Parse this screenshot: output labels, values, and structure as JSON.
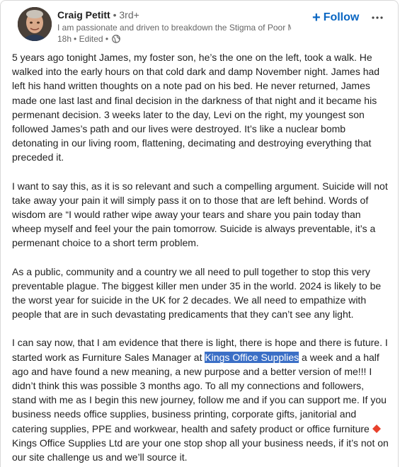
{
  "author": {
    "name": "Craig Petitt",
    "degree": "• 3rd+",
    "headline": "I am passionate and driven to breakdown the Stigma of Poor M...",
    "time": "18h",
    "edited": "• Edited •",
    "visibility_icon": "globe-icon"
  },
  "actions": {
    "follow_plus": "+",
    "follow_label": "Follow",
    "more_label": "•••"
  },
  "post": {
    "p1": "5 years ago tonight James, my foster son, he’s the one on the left, took a walk. He walked into the early hours on that cold dark and damp November night. James had left his hand written thoughts on a note pad on his bed. He never returned, James made one last last and final decision in the darkness of that night and it became his permenant decision. 3 weeks later to the day, Levi on the right, my youngest son followed James’s path and our lives were destroyed. It’s like a nuclear bomb detonating in our living room, flattening, decimating and destroying everything that preceded it.",
    "p2": "I want to say this, as it is so relevant and such a compelling argument. Suicide will not take away your pain it will simply pass it on to those that are left behind. Words of wisdom are “I would rather wipe away your tears and share you pain today than wheep myself and feel your the pain tomorrow. Suicide is always preventable, it’s a permenant choice to a short term problem.",
    "p3": "As a public, community and a country we all need to pull together to stop this very preventable plague. The biggest killer men under 35 in the world. 2024 is likely to be the worst year for suicide in the UK for 2 decades. We all need to empathize with people that are in such devastating predicaments that they can’t see any light.",
    "p4_start": "I can say now, that I am evidence that there is light, there is hope and there is future. I started work as Furniture Sales Manager at ",
    "p4_highlight": "Kings Office Supplies",
    "p4_end": " a week and a half ago and have found a new meaning, a new purpose and a better version of me!!! I didn’t think this was possible 3 months ago. To all my connections and followers, stand with me as I begin this new journey, follow me and if you can support me. If you business needs office supplies, business printing, corporate gifts, janitorial and catering supplies, PPE and workwear, health and safety product or office furniture ",
    "p4_tail": "Kings Office Supplies Ltd are your one stop shop all your business needs, if it’s not on our site challenge us and we’ll source it.",
    "icons": {
      "diamond": "red-diamond-icon"
    },
    "colors": {
      "highlight": "#3b6fc6",
      "diamond": "#e8412c"
    }
  },
  "colors": {
    "accent": "#0a66c2",
    "secondary_text": "#666666",
    "text": "#1f1f1f"
  }
}
